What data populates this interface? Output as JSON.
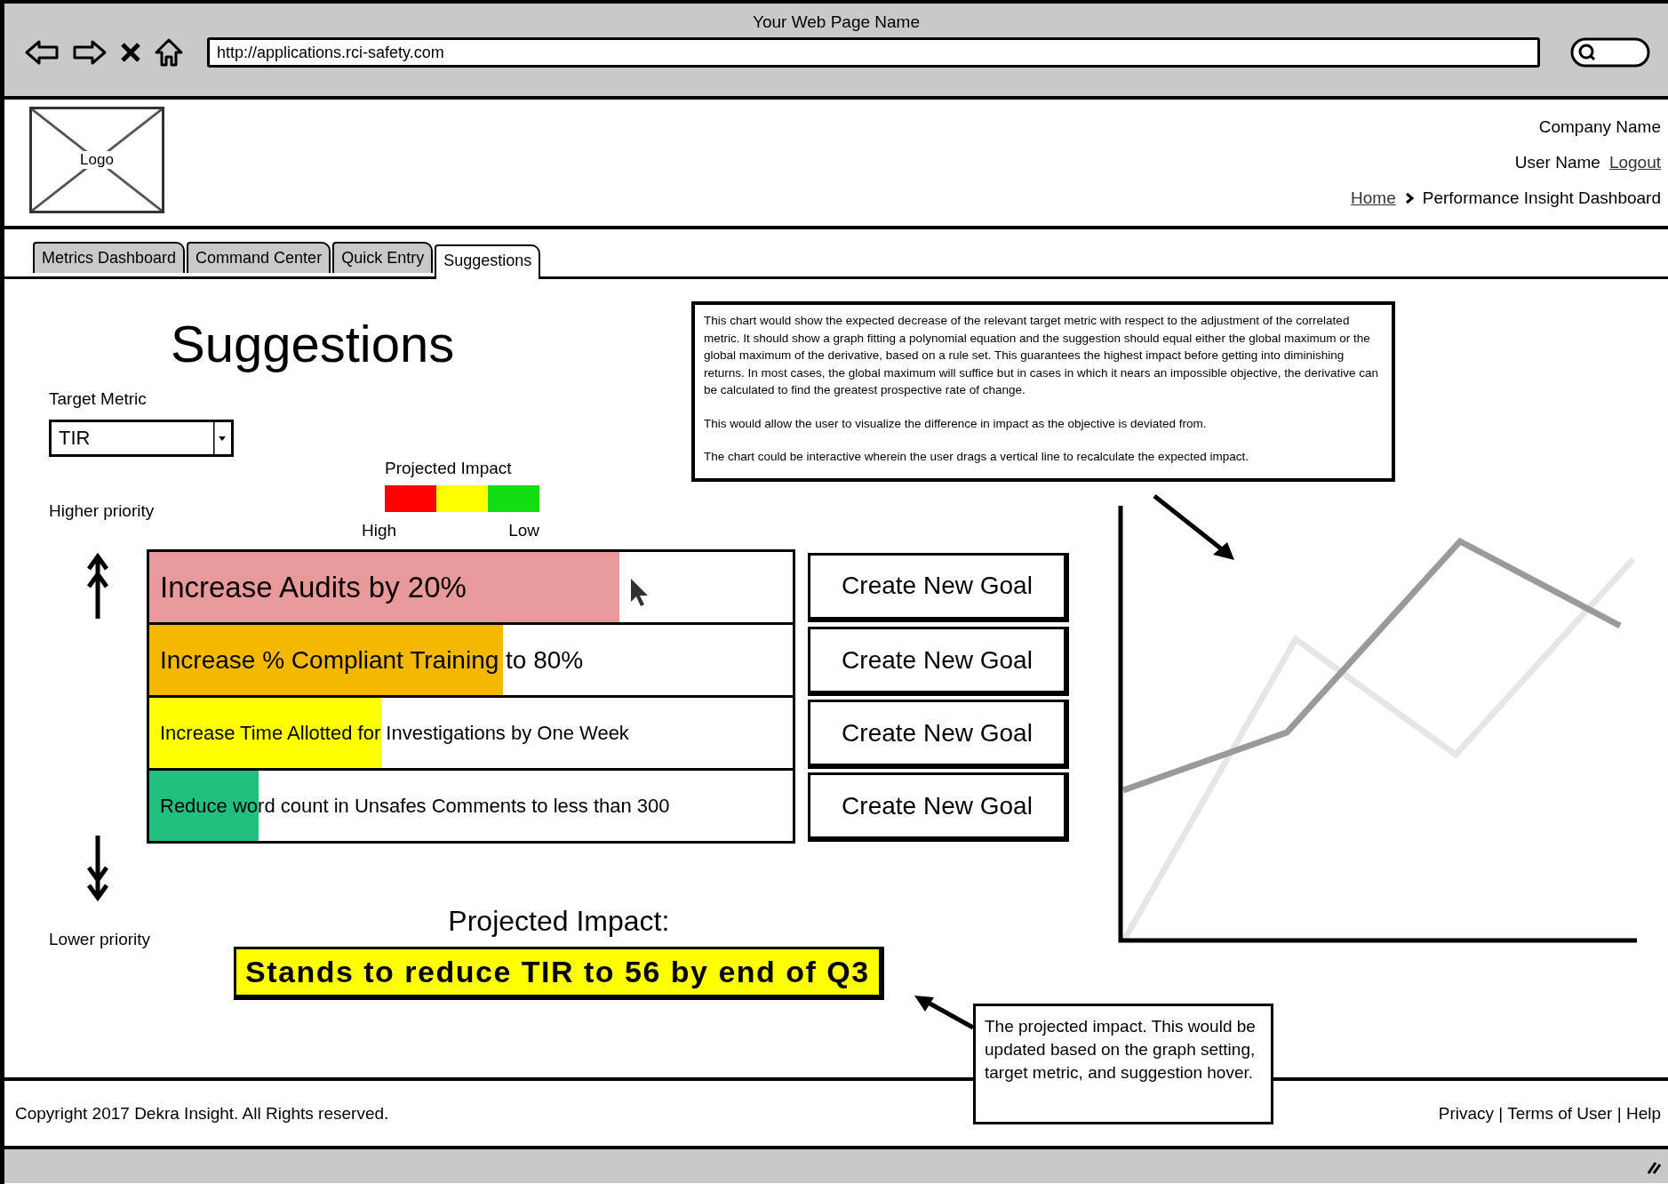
{
  "browser": {
    "title": "Your Web Page Name",
    "url": "http://applications.rci-safety.com"
  },
  "header": {
    "logo": "Logo",
    "company": "Company Name",
    "user": "User Name",
    "logout": "Logout",
    "breadcrumb_home": "Home",
    "breadcrumb_current": "Performance Insight Dashboard"
  },
  "tabs": [
    {
      "label": "Metrics Dashboard",
      "selected": false
    },
    {
      "label": "Command Center",
      "selected": false
    },
    {
      "label": "Quick Entry",
      "selected": false
    },
    {
      "label": "Suggestions",
      "selected": true
    }
  ],
  "page_title": "Suggestions",
  "target_metric": {
    "label": "Target Metric",
    "value": "TIR"
  },
  "legend": {
    "title": "Projected Impact",
    "high": "High",
    "low": "Low",
    "segments": [
      {
        "color": "#ff0000"
      },
      {
        "color": "#ffff00"
      },
      {
        "color": "#11dd11"
      }
    ]
  },
  "priority": {
    "higher": "Higher priority",
    "lower": "Lower priority"
  },
  "suggestions": [
    {
      "text": "Increase Audits by 20%",
      "level": 0.73,
      "color": "#e89a9a",
      "button": "Create New Goal"
    },
    {
      "text": "Increase % Compliant Training to 80%",
      "level": 0.55,
      "color": "#f5b800",
      "button": "Create New Goal"
    },
    {
      "text": "Increase Time Allotted for Investigations by One Week",
      "level": 0.36,
      "color": "#ffff00",
      "button": "Create New Goal"
    },
    {
      "text": "Reduce word count in Unsafes Comments to less than 300",
      "level": 0.17,
      "color": "#22c07e",
      "button": "Create New Goal"
    }
  ],
  "projected_impact": {
    "heading": "Projected Impact:",
    "value": "Stands to reduce TIR to 56 by end of Q3"
  },
  "chart_note": {
    "paragraphs": [
      "This chart would show the expected decrease of the relevant target metric with respect to the adjustment of the correlated metric.  It should show a graph fitting a polynomial equation and the suggestion should equal either the global maximum or the global maximum of the derivative, based on a rule set.  This guarantees the highest impact before getting into diminishing returns.  In most cases, the global maximum will suffice but in cases in which it nears an impossible objective, the derivative can be calculated to find the greatest prospective rate of change.",
      "This would allow the user to visualize the difference in impact as the objective is deviated from.",
      "The chart could be interactive wherein the user drags a vertical line to recalculate the expected impact."
    ]
  },
  "impact_note": {
    "text": "The projected impact.  This would be updated based on the graph setting, target metric, and suggestion hover."
  },
  "footer": {
    "copyright": "Copyright 2017 Dekra Insight. All Rights reserved.",
    "links": "Privacy | Terms of User | Help"
  }
}
